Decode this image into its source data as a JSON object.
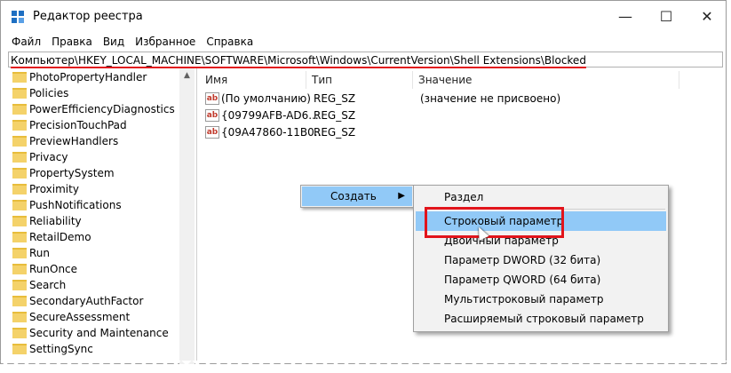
{
  "window": {
    "title": "Редактор реестра"
  },
  "menu": [
    "Файл",
    "Правка",
    "Вид",
    "Избранное",
    "Справка"
  ],
  "address": {
    "prefix": "Компьютер\\",
    "path": "HKEY_LOCAL_MACHINE\\SOFTWARE\\Microsoft\\Windows\\CurrentVersion\\Shell Extensions\\Blocked"
  },
  "tree": [
    "PhotoPropertyHandler",
    "Policies",
    "PowerEfficiencyDiagnostics",
    "PrecisionTouchPad",
    "PreviewHandlers",
    "Privacy",
    "PropertySystem",
    "Proximity",
    "PushNotifications",
    "Reliability",
    "RetailDemo",
    "Run",
    "RunOnce",
    "Search",
    "SecondaryAuthFactor",
    "SecureAssessment",
    "Security and Maintenance",
    "SettingSync"
  ],
  "columns": {
    "name": "Имя",
    "type": "Тип",
    "value": "Значение"
  },
  "rows": [
    {
      "name": "(По умолчанию)",
      "type": "REG_SZ",
      "value": "(значение не присвоено)"
    },
    {
      "name": "{09799AFB-AD6...",
      "type": "REG_SZ",
      "value": ""
    },
    {
      "name": "{09A47860-11B0...",
      "type": "REG_SZ",
      "value": ""
    }
  ],
  "context_menu": {
    "label": "Создать"
  },
  "submenu": [
    "Раздел",
    "Строковый параметр",
    "Двоичный параметр",
    "Параметр DWORD (32 бита)",
    "Параметр QWORD (64 бита)",
    "Мультистроковый параметр",
    "Расширяемый строковый параметр"
  ],
  "icons": {
    "app": "registry-icon",
    "value": "ab-string-icon"
  },
  "colors": {
    "highlight": "#91c9f7",
    "annotation": "#e2141b"
  }
}
